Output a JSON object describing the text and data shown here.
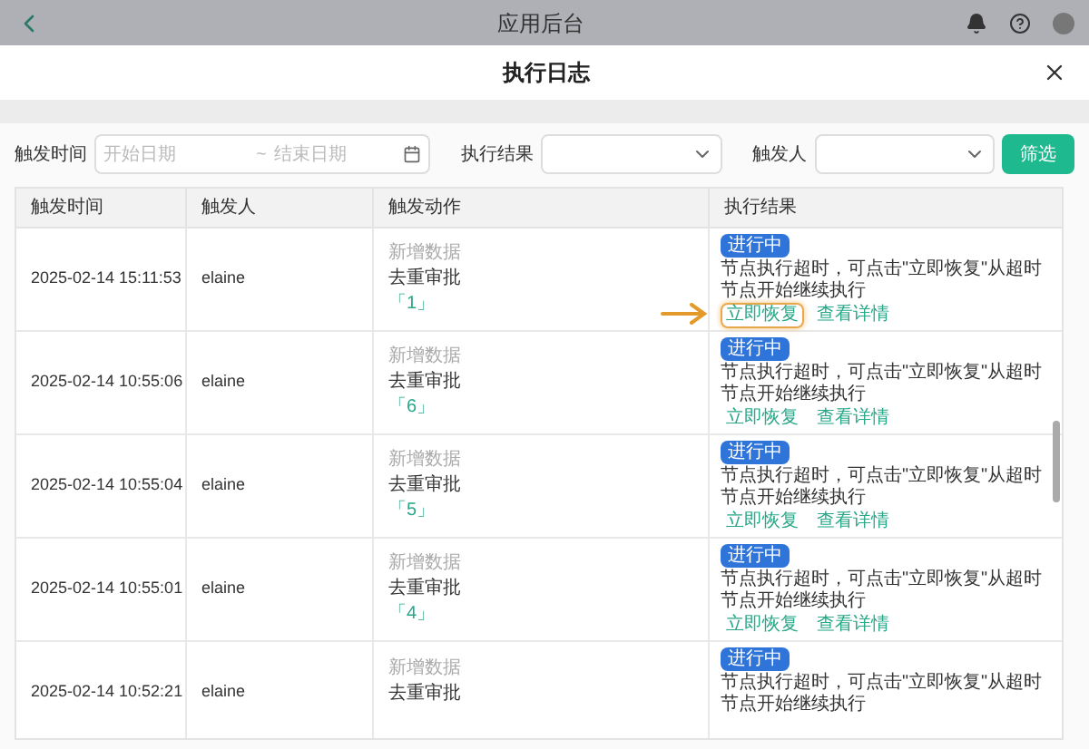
{
  "app_bar": {
    "title": "应用后台"
  },
  "dialog": {
    "title": "执行日志"
  },
  "filters": {
    "time_label": "触发时间",
    "start_placeholder": "开始日期",
    "separator": "~",
    "end_placeholder": "结束日期",
    "result_label": "执行结果",
    "trigger_label": "触发人",
    "button": "筛选"
  },
  "table": {
    "columns": [
      "触发时间",
      "触发人",
      "触发动作",
      "执行结果"
    ],
    "rows": [
      {
        "time": "2025-02-14 15:11:53",
        "user": "elaine",
        "action_type": "新增数据",
        "action_name": "去重审批",
        "ref": "「1」",
        "status": "进行中",
        "message": "节点执行超时，可点击\"立即恢复\"从超时节点开始继续执行",
        "links": [
          {
            "label": "立即恢复",
            "highlighted": true
          },
          {
            "label": "查看详情",
            "highlighted": false
          }
        ]
      },
      {
        "time": "2025-02-14 10:55:06",
        "user": "elaine",
        "action_type": "新增数据",
        "action_name": "去重审批",
        "ref": "「6」",
        "status": "进行中",
        "message": "节点执行超时，可点击\"立即恢复\"从超时节点开始继续执行",
        "links": [
          {
            "label": "立即恢复",
            "highlighted": false
          },
          {
            "label": "查看详情",
            "highlighted": false
          }
        ]
      },
      {
        "time": "2025-02-14 10:55:04",
        "user": "elaine",
        "action_type": "新增数据",
        "action_name": "去重审批",
        "ref": "「5」",
        "status": "进行中",
        "message": "节点执行超时，可点击\"立即恢复\"从超时节点开始继续执行",
        "links": [
          {
            "label": "立即恢复",
            "highlighted": false
          },
          {
            "label": "查看详情",
            "highlighted": false
          }
        ]
      },
      {
        "time": "2025-02-14 10:55:01",
        "user": "elaine",
        "action_type": "新增数据",
        "action_name": "去重审批",
        "ref": "「4」",
        "status": "进行中",
        "message": "节点执行超时，可点击\"立即恢复\"从超时节点开始继续执行",
        "links": [
          {
            "label": "立即恢复",
            "highlighted": false
          },
          {
            "label": "查看详情",
            "highlighted": false
          }
        ]
      },
      {
        "time": "2025-02-14 10:52:21",
        "user": "elaine",
        "action_type": "新增数据",
        "action_name": "去重审批",
        "status": "进行中",
        "message": "节点执行超时，可点击\"立即恢复\"从超时节点开始继续执行"
      }
    ]
  }
}
